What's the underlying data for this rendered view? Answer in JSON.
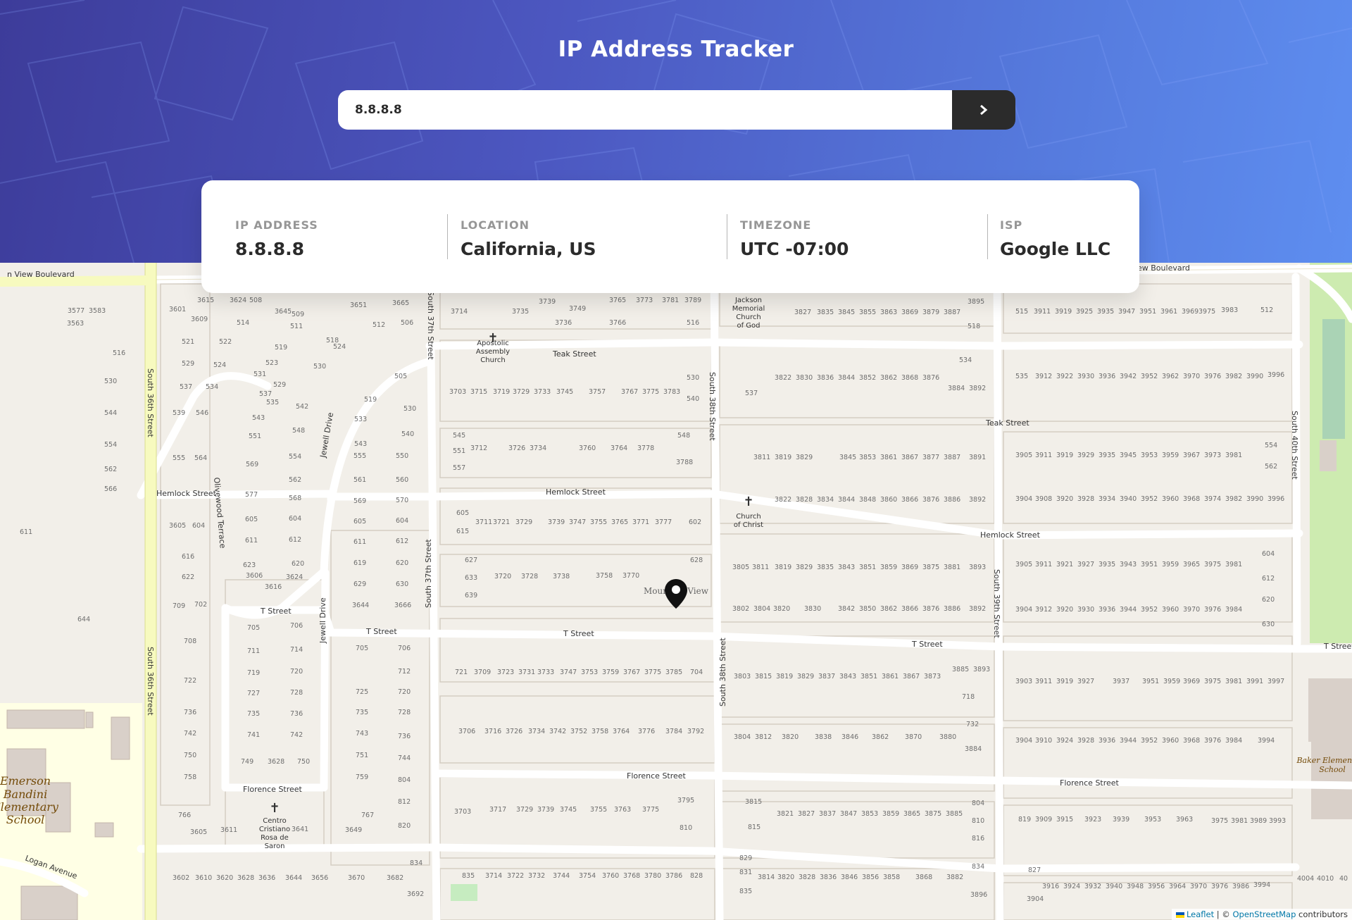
{
  "header": {
    "title": "IP Address Tracker"
  },
  "search": {
    "value": "8.8.8.8",
    "submit_icon": "chevron-right-icon"
  },
  "info": {
    "ip_label": "IP ADDRESS",
    "ip_value": "8.8.8.8",
    "location_label": "LOCATION",
    "location_value": "California, US",
    "timezone_label": "TIMEZONE",
    "timezone_value": "UTC -07:00",
    "isp_label": "ISP",
    "isp_value": "Google LLC"
  },
  "map": {
    "marker_icon": "location-pin-icon",
    "streets": [
      "Teak Street",
      "Hemlock Street",
      "T Street",
      "Florence Street",
      "Logan Avenue",
      "South 36th Street",
      "South 37th Street",
      "South 38th Street",
      "South 39th Street",
      "South 40th Street",
      "Jewell Drive",
      "Olivewood Terrace",
      "View Boulevard",
      "n View Boulevard",
      "Mountain View"
    ],
    "places": [
      "Apostolic Assembly Church",
      "Jackson Memorial Church of God",
      "Church of Christ",
      "Centro Cristiano Rosa de Saron",
      "Emerson Bandini Elementary School",
      "Baker Elementary School"
    ],
    "attribution": {
      "leaflet": "Leaflet",
      "sep": " | © ",
      "osm": "OpenStreetMap",
      "suffix": " contributors"
    }
  },
  "colors": {
    "header_start": "#3d3c9a",
    "header_end": "#5e8ef0",
    "text_dark": "#2b2b2b",
    "label_gray": "#969696",
    "map_bg": "#f2efe9",
    "road": "#ffffff",
    "main_road": "#f7fabf",
    "school": "#ffffe5",
    "park": "#cdebb0"
  }
}
